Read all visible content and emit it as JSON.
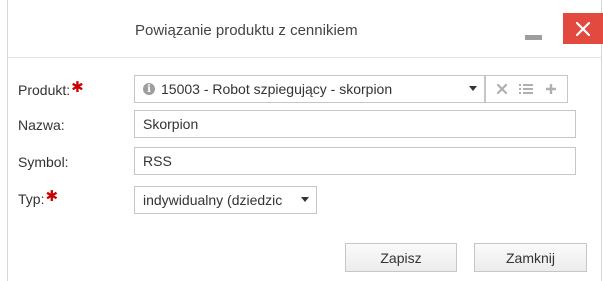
{
  "dialog": {
    "title": "Powiązanie produktu z cennikiem"
  },
  "form": {
    "product": {
      "label": "Produkt:",
      "required_mark": "✱",
      "value": "15003 - Robot szpiegujący - skorpion",
      "info_icon_glyph": "i"
    },
    "name": {
      "label": "Nazwa:",
      "value": "Skorpion"
    },
    "symbol": {
      "label": "Symbol:",
      "value": "RSS"
    },
    "type": {
      "label": "Typ:",
      "required_mark": "✱",
      "value": "indywidualny (dziedzic"
    }
  },
  "buttons": {
    "save": "Zapisz",
    "close": "Zamknij"
  },
  "colors": {
    "close_button": "#e24a40",
    "required": "#cc0000"
  },
  "icons": [
    "minimize-icon",
    "close-icon",
    "info-icon",
    "clear-icon",
    "list-icon",
    "add-icon",
    "chevron-down-icon"
  ]
}
